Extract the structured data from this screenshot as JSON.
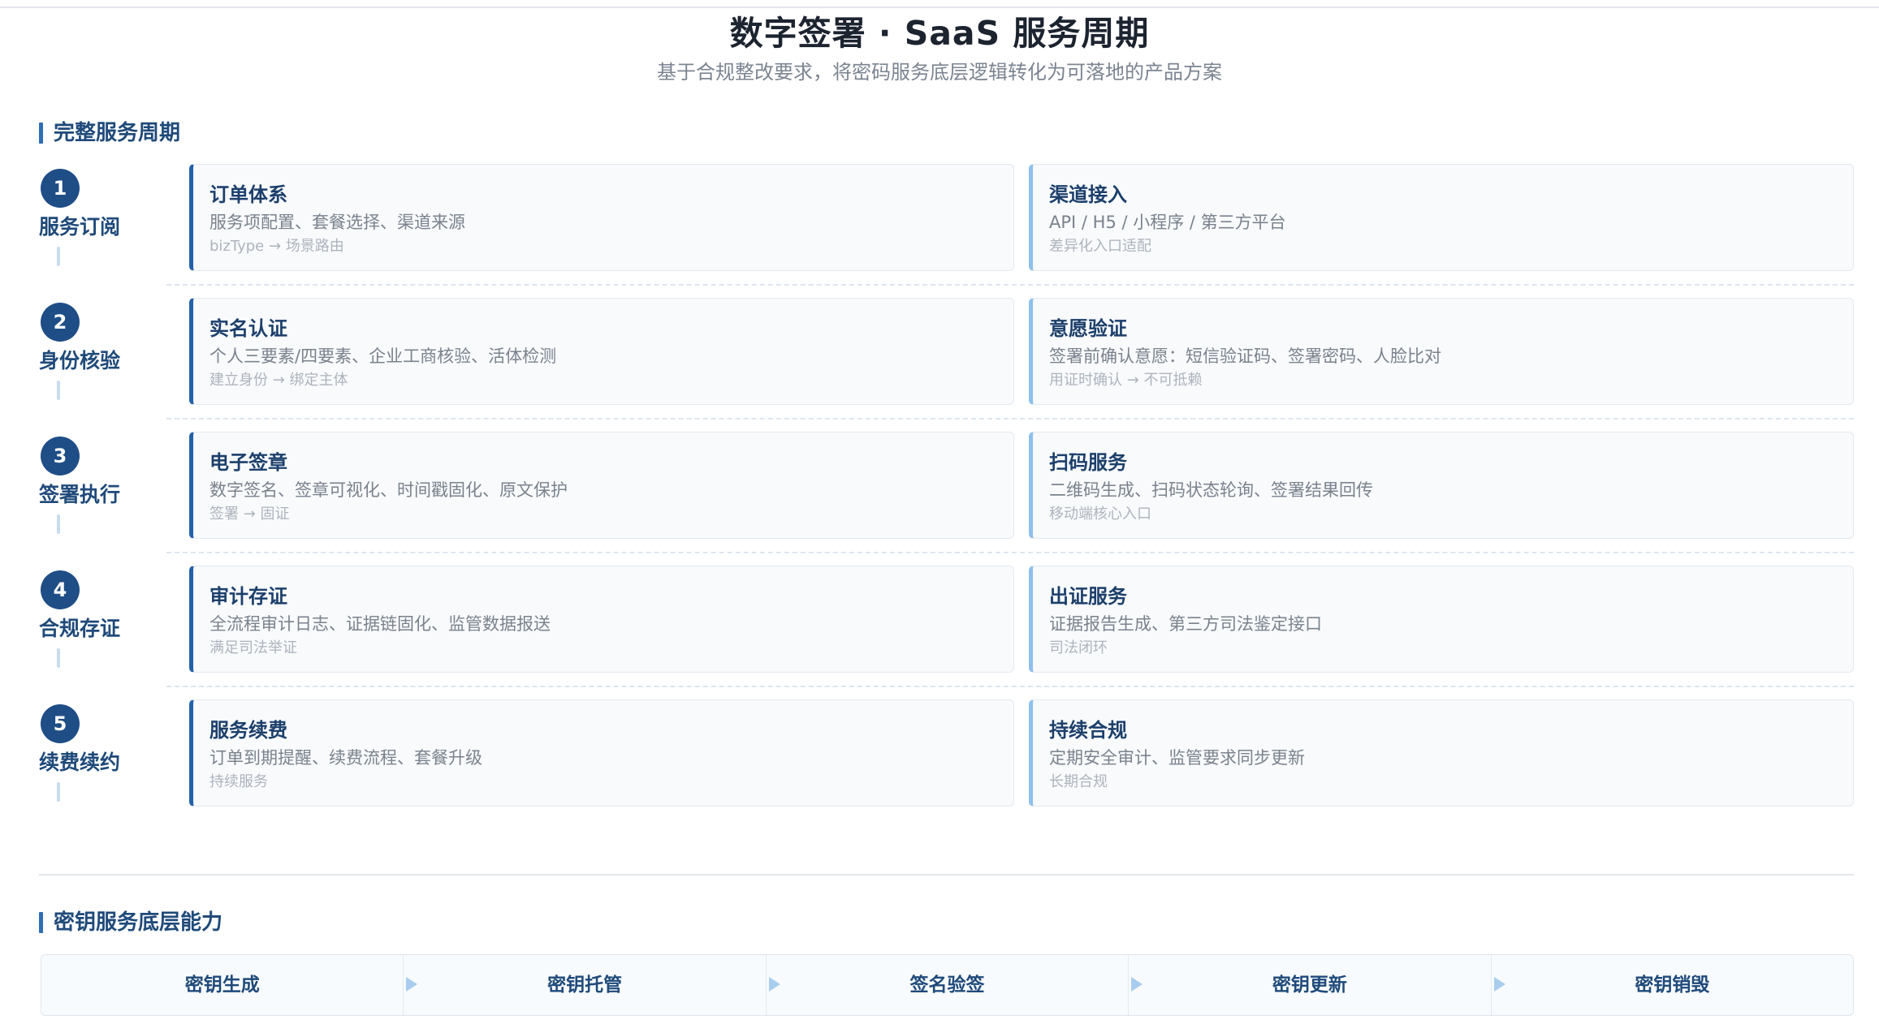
{
  "header": {
    "title": "数字签署 · SaaS 服务周期",
    "subtitle": "基于合规整改要求，将密码服务底层逻辑转化为可落地的产品方案"
  },
  "sections": {
    "lifecycle_title": "完整服务周期",
    "key_title": "密钥服务底层能力"
  },
  "phases": [
    {
      "step": "1",
      "label": "服务订阅",
      "primary": {
        "title": "订单体系",
        "desc": "服务项配置、套餐选择、渠道来源",
        "note": "bizType → 场景路由"
      },
      "secondary": {
        "title": "渠道接入",
        "desc": "API / H5 / 小程序 / 第三方平台",
        "note": "差异化入口适配"
      }
    },
    {
      "step": "2",
      "label": "身份核验",
      "primary": {
        "title": "实名认证",
        "desc": "个人三要素/四要素、企业工商核验、活体检测",
        "note": "建立身份 → 绑定主体"
      },
      "secondary": {
        "title": "意愿验证",
        "desc": "签署前确认意愿：短信验证码、签署密码、人脸比对",
        "note": "用证时确认 → 不可抵赖"
      }
    },
    {
      "step": "3",
      "label": "签署执行",
      "primary": {
        "title": "电子签章",
        "desc": "数字签名、签章可视化、时间戳固化、原文保护",
        "note": "签署 → 固证"
      },
      "secondary": {
        "title": "扫码服务",
        "desc": "二维码生成、扫码状态轮询、签署结果回传",
        "note": "移动端核心入口"
      }
    },
    {
      "step": "4",
      "label": "合规存证",
      "primary": {
        "title": "审计存证",
        "desc": "全流程审计日志、证据链固化、监管数据报送",
        "note": "满足司法举证"
      },
      "secondary": {
        "title": "出证服务",
        "desc": "证据报告生成、第三方司法鉴定接口",
        "note": "司法闭环"
      }
    },
    {
      "step": "5",
      "label": "续费续约",
      "primary": {
        "title": "服务续费",
        "desc": "订单到期提醒、续费流程、套餐升级",
        "note": "持续服务"
      },
      "secondary": {
        "title": "持续合规",
        "desc": "定期安全审计、监管要求同步更新",
        "note": "长期合规"
      }
    }
  ],
  "key_services": [
    "密钥生成",
    "密钥托管",
    "签名验签",
    "密钥更新",
    "密钥销毁"
  ],
  "colors": {
    "primary_accent": "#2461a6",
    "secondary_accent": "#8ec0eb",
    "step_circle": "#1f4d86",
    "heading": "#1f4a7a"
  }
}
